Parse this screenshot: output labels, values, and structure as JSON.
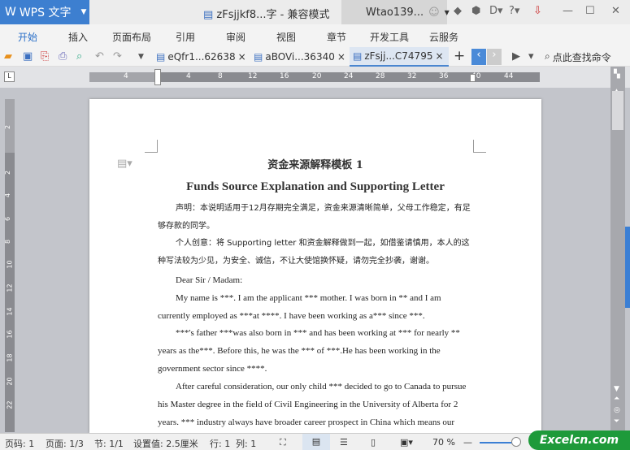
{
  "app": {
    "name": "WPS 文字",
    "doc_title": "zFsjjkf8...字 - 兼容模式",
    "user": "Wtao139..."
  },
  "menu": [
    "开始",
    "插入",
    "页面布局",
    "引用",
    "审阅",
    "视图",
    "章节",
    "开发工具",
    "云服务"
  ],
  "tabs": [
    {
      "label": "eQfr1...62638"
    },
    {
      "label": "aBOVi...36340"
    },
    {
      "label": "zFsjj...C74795"
    }
  ],
  "search_label": "点此查找命令",
  "ruler": {
    "h": [
      "4",
      "4",
      "8",
      "12",
      "16",
      "20",
      "24",
      "28",
      "32",
      "36",
      "40",
      "44"
    ],
    "v": [
      "2",
      "2",
      "4",
      "6",
      "8",
      "10",
      "12",
      "14",
      "16",
      "18",
      "20",
      "22"
    ]
  },
  "document": {
    "title": "资金来源解释模板 1",
    "subtitle": "Funds Source Explanation and Supporting Letter",
    "paragraphs": [
      "声明：本说明适用于12月存期完全满足，资金来源清晰简单，父母工作稳定，有足够存款的同学。",
      "个人创意：将 Supporting letter 和资金解释做到一起，如借鉴请慎用，本人的这种写法较为少见，为安全、诚信，不让大使馆换怀疑，请勿完全抄袭，谢谢。",
      "Dear Sir / Madam:",
      "My name is ***. I am the applicant *** mother. I was born in ** and I am currently employed as ***at ****. I have been working as a*** since ***.",
      "***'s father ***was also born in *** and has been working at *** for nearly ** years as the***. Before this, he was the *** of ***.He has been working in the government sector since ****.",
      "After careful consideration, our only child *** decided to go to Canada to pursue his Master degree in the field of Civil Engineering in the University of Alberta for 2 years. *** industry always have broader career prospect in China which means our"
    ]
  },
  "status": {
    "page_no": "页码: 1",
    "pages": "页面: 1/3",
    "section": "节: 1/1",
    "setting": "设置值: 2.5厘米",
    "row": "行: 1",
    "col": "列: 1",
    "zoom": "70 %",
    "zoom_level": 70
  },
  "brand": "Excelcn.com"
}
